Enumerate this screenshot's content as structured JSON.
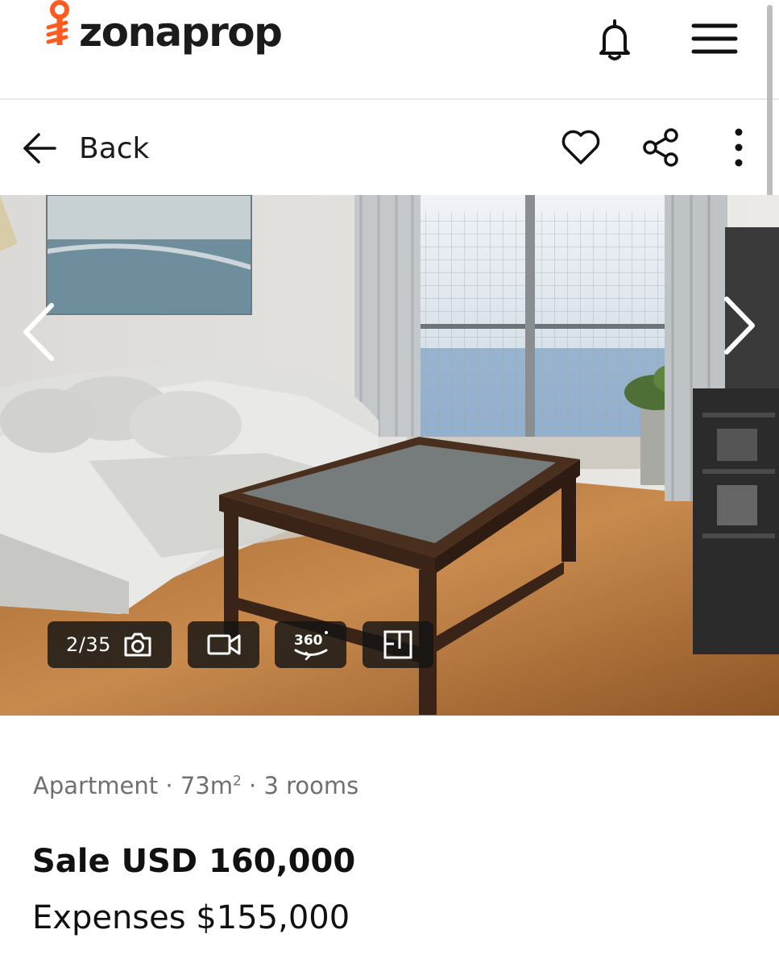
{
  "header": {
    "logo_text": "zonaprop",
    "brand_color": "#ff5a1f",
    "bell_icon": "bell-icon",
    "menu_icon": "hamburger-menu-icon"
  },
  "actions": {
    "back_label": "Back",
    "favorite_icon": "heart-icon",
    "share_icon": "share-icon",
    "more_icon": "more-vertical-icon"
  },
  "gallery": {
    "photo_counter": "2/35",
    "media_chips": [
      {
        "icon": "camera-icon"
      },
      {
        "icon": "video-icon"
      },
      {
        "icon": "360-view-icon",
        "label": "360"
      },
      {
        "icon": "floor-plan-icon"
      }
    ],
    "prev_icon": "chevron-left-icon",
    "next_icon": "chevron-right-icon"
  },
  "listing": {
    "type": "Apartment",
    "area": "73m",
    "area_unit_sup": "2",
    "rooms": "3 rooms",
    "separator": "·",
    "price": "Sale USD 160,000",
    "expenses": "Expenses $155,000"
  }
}
